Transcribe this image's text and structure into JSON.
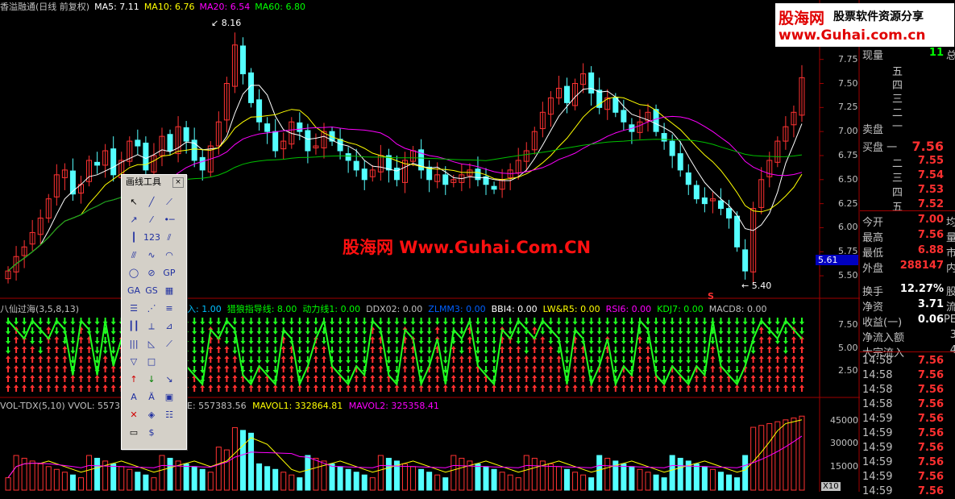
{
  "top": {
    "title": "香溢融通(日线 前复权)",
    "ma5": "MA5: 7.11",
    "ma10": "MA10: 6.76",
    "ma20": "MA20: 6.54",
    "ma60": "MA60: 6.80"
  },
  "brand": {
    "line1a": "股海网",
    "line1b": "股票软件资源分享",
    "line2": "www.Guhai.com.cn"
  },
  "watermark": "股海网 Www.Guhai.Com.CN",
  "price_labels": {
    "high": "8.16",
    "low": "5.40",
    "current": "5.61",
    "s_mark": "S"
  },
  "price_axis": [
    "7.75",
    "7.50",
    "7.25",
    "7.00",
    "6.75",
    "6.50",
    "6.25",
    "6.00",
    "5.75",
    "5.50"
  ],
  "indicator": {
    "name": "八仙过海(3,5,8,13)",
    "items": [
      {
        "text": "入: 1.00",
        "color": "#00c0ff"
      },
      {
        "text": "猎狼指导线: 8.00",
        "color": "#00ff00"
      },
      {
        "text": "动力线1: 0.00",
        "color": "#00ff00"
      },
      {
        "text": "DDX02: 0.00",
        "color": "#c0c0c0"
      },
      {
        "text": "ZLMM3: 0.00",
        "color": "#0060ff"
      },
      {
        "text": "BBI4: 0.00",
        "color": "#ffffff"
      },
      {
        "text": "LW&R5: 0.00",
        "color": "#ffff00"
      },
      {
        "text": "RSI6: 0.00",
        "color": "#ff00ff"
      },
      {
        "text": "KDJ7: 0.00",
        "color": "#00ff00"
      },
      {
        "text": "MACD8: 0.00",
        "color": "#c0c0c0"
      }
    ],
    "axis": [
      "7.50",
      "5.00",
      "2.50"
    ]
  },
  "volume": {
    "name": "VOL-TDX(5,10)",
    "vol": "VVOL: 5573",
    "e": "E: 557383.56",
    "mavol1": "MAVOL1: 332864.81",
    "mavol2": "MAVOL2: 325358.41",
    "axis": [
      "45000",
      "30000",
      "15000"
    ],
    "unit": "X10"
  },
  "toolbox": {
    "title": "画线工具",
    "close": "×",
    "tools": [
      "cursor-icon",
      "line-icon",
      "ray-icon",
      "arrow-line-icon",
      "extend-line-icon",
      "point-line-icon",
      "vertical-line-icon",
      "123-icon",
      "parallel-icon",
      "channel-icon",
      "wave-icon",
      "arc-icon",
      "circle-icon",
      "cross-circle-icon",
      "gp-icon",
      "ga-icon",
      "gs-icon",
      "grid-icon",
      "fibo-icon",
      "fan-icon",
      "levels-icon",
      "period-icon",
      "speed-icon",
      "gann-icon",
      "bars-icon",
      "gann-fan-icon",
      "fan-lines-icon",
      "triangle-icon",
      "rect-icon",
      "blank-icon",
      "up-arrow-icon",
      "down-arrow-icon",
      "cross-arrow-icon",
      "text-icon",
      "text-edit-icon",
      "box-icon",
      "delete-icon",
      "palette-icon",
      "list-icon",
      "ruler-icon",
      "money-icon"
    ],
    "tool_text": {
      "gp": "GP",
      "ga": "GA",
      "gs": "GS",
      "n123": "123"
    }
  },
  "right_panel": {
    "xianliang_label": "现量",
    "xianliang_val": "11",
    "zong": "总",
    "sell_labels": [
      "五",
      "四",
      "三",
      "二",
      "一"
    ],
    "sell_head": "卖盘",
    "buy_head": "买盘",
    "buy_labels": [
      "一",
      "二",
      "三",
      "四",
      "五"
    ],
    "buy_vals": [
      "7.56",
      "7.55",
      "7.54",
      "7.53",
      "7.52"
    ],
    "stats": [
      {
        "label": "今开",
        "val": "7.00",
        "ext": "均"
      },
      {
        "label": "最高",
        "val": "7.56",
        "ext": "量"
      },
      {
        "label": "最低",
        "val": "6.88",
        "ext": "市"
      },
      {
        "label": "外盘",
        "val": "288147",
        "ext": "内"
      },
      {
        "label": "换手",
        "val": "12.27%",
        "ext": "股"
      },
      {
        "label": "净资",
        "val": "3.71",
        "ext": "流"
      },
      {
        "label": "收益(一)",
        "val": "0.06",
        "ext": "PE"
      },
      {
        "label": "净流入额",
        "val": "",
        "ext": "3"
      },
      {
        "label": "大宗流入",
        "val": "",
        "ext": "4"
      }
    ],
    "ticks": [
      {
        "t": "14:58",
        "p": "7.56"
      },
      {
        "t": "14:58",
        "p": "7.56"
      },
      {
        "t": "14:58",
        "p": "7.56"
      },
      {
        "t": "14:58",
        "p": "7.56"
      },
      {
        "t": "14:59",
        "p": "7.56"
      },
      {
        "t": "14:59",
        "p": "7.56"
      },
      {
        "t": "14:59",
        "p": "7.56"
      },
      {
        "t": "14:59",
        "p": "7.56"
      },
      {
        "t": "14:59",
        "p": "7.56"
      },
      {
        "t": "14:59",
        "p": "7.56"
      }
    ]
  },
  "colors": {
    "up": "#ff3232",
    "down": "#54ffff",
    "ma5": "#ffffff",
    "ma10": "#ffff00",
    "ma20": "#ff00ff",
    "ma60": "#00c000"
  },
  "chart_data": {
    "type": "candlestick",
    "price_axis_range": [
      5.4,
      8.16
    ],
    "closes": [
      5.55,
      5.7,
      5.8,
      5.95,
      6.1,
      6.3,
      6.55,
      6.6,
      6.35,
      6.45,
      6.7,
      6.65,
      6.8,
      6.55,
      6.7,
      6.9,
      6.85,
      6.6,
      6.75,
      6.95,
      6.8,
      7.05,
      6.9,
      6.7,
      6.6,
      6.85,
      7.1,
      7.5,
      7.9,
      7.6,
      7.3,
      7.1,
      7.0,
      6.8,
      6.9,
      7.1,
      7.0,
      6.8,
      6.85,
      7.0,
      6.9,
      6.8,
      6.7,
      6.6,
      6.5,
      6.6,
      6.75,
      6.6,
      6.5,
      6.7,
      6.8,
      6.6,
      6.5,
      6.55,
      6.45,
      6.5,
      6.55,
      6.6,
      6.5,
      6.45,
      6.4,
      6.5,
      6.6,
      6.7,
      6.8,
      7.0,
      7.2,
      7.35,
      7.45,
      7.3,
      7.5,
      7.6,
      7.4,
      7.25,
      7.35,
      7.2,
      7.1,
      7.0,
      7.1,
      7.2,
      7.0,
      6.9,
      6.75,
      6.6,
      6.45,
      6.3,
      6.25,
      6.3,
      6.2,
      6.1,
      5.8,
      5.55,
      6.2,
      6.5,
      6.7,
      6.9,
      7.05,
      7.2,
      7.56
    ],
    "volume_range": [
      0,
      50000
    ]
  }
}
